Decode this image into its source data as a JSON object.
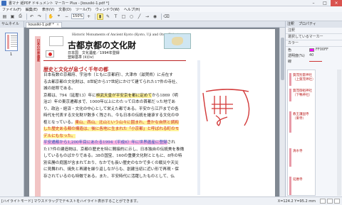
{
  "window": {
    "title": "書マナ 紙PDF ドキュメント マーカー Plus - [kousiki-1.pdf *]"
  },
  "menu": [
    "ファイル(F)",
    "編集(E)",
    "表示(V)",
    "文書(D)",
    "ツール(T)",
    "ウィンドウ(W)",
    "ヘルプ(H)"
  ],
  "toolbar": {
    "zoom": "150%"
  },
  "tab": {
    "label": "kousiki-1.pdf *"
  },
  "left_pane": {
    "title": "サムネイル",
    "page_number": "1"
  },
  "page": {
    "side_title": "日本の世界遺産",
    "series": "Historic Monuments of Ancient Kyoto (Kyoto, Uji and Otsu Cities)",
    "title": "古都京都の文化財",
    "meta_line1": "日本国　文化遺産／1994年登録",
    "meta_line2": "登録基準 (ii)(iv)",
    "section_heading": "歴史と文化が息づく千年の都",
    "paragraphs": [
      [
        "日本有数の京都府、宇治市（ともに京都府）、大津市（滋賀県）に点在す",
        ""
      ],
      [
        "る古都京都の文化財は、8世紀から17世紀にかけて建てられた17件の寺社、",
        ""
      ],
      [
        "城の総称である。",
        ""
      ],
      [
        "京都は、794（延暦13）年に",
        "桓武天皇が平安京を都に定めて",
        "から1869（明"
      ],
      [
        "治2）年の東京遷都まで、1000年以上にわたって日本の首都だった地であ",
        "",
        ""
      ],
      [
        "り、政治・経済・文化の中心として栄えた都である。平安から江戸までの各",
        "",
        ""
      ],
      [
        "時代を代表する文化財が数多く残され、今も日本の伝統を継承する文化の中",
        "",
        ""
      ],
      [
        "枢となっている。",
        "東山、西山、北山という山々に囲まれ、豊かな自然と調和",
        ""
      ],
      [
        "した歴史ある都の構造は、",
        "後に各地に生まれた「小京都」と呼ばれる町のモ",
        ""
      ],
      [
        "デルにもなった。",
        "",
        ""
      ],
      [
        "",
        "平安遷都から1,200年目にあたる1994（平成6）年に世界遺産に登録",
        "され"
      ],
      [
        "た17件の建造物は、京都の歴史を特に間接的に示し、日本独自の伝統美を象徴",
        "",
        ""
      ],
      [
        "しているものばかりである。38の国宝、160の重要文化財とともに、8件の特",
        "",
        ""
      ],
      [
        "別名勝の庭園が含まれており、なかでも長い歴史のなかで多くの戦災や天災",
        "",
        ""
      ],
      [
        "に見舞われ、焼失と再建を繰り返しながらも、創建当初に近い形で再現・保",
        "",
        ""
      ],
      [
        "存されているのも特徴である。また、平安時代に活躍したものとして、仏",
        "",
        ""
      ]
    ]
  },
  "right_pane": {
    "tabs": [
      "注釈",
      "プロパティ"
    ],
    "section1": "注釈",
    "section2": "選択しているマーカー",
    "section3": "カラー",
    "color_label": "色",
    "color_value": "FF00FF",
    "opacity_label": "透明度(%)",
    "opacity_value": "40",
    "line_label": "線",
    "annotations": [
      "賀茂別雷神社（上賀茂神社）",
      "賀茂御祖神社（下鴨神社）",
      "教王護国寺（東寺）",
      "清水寺",
      "延暦寺"
    ]
  },
  "status": {
    "left": "[ハイライトモード] マウスドラッグでテキストをハイライト表示することができます。",
    "coords": "X=124.2 Y=95.2 mm"
  },
  "colors": {
    "accent": "#b22222",
    "yellow_highlight": "#fff39a",
    "pink_highlight": "#f7b0e0",
    "ink": "#d23838"
  }
}
